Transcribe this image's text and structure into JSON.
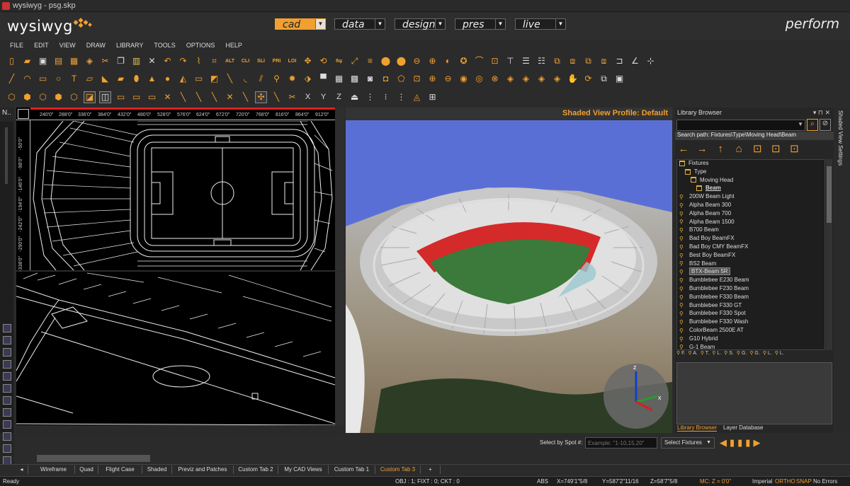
{
  "window": {
    "title": "wysiwyg - psg.skp"
  },
  "header": {
    "logo": "wysiwyg",
    "modes": [
      {
        "label": "cad",
        "active": true
      },
      {
        "label": "data",
        "active": false
      },
      {
        "label": "design",
        "active": false
      },
      {
        "label": "pres",
        "active": false
      },
      {
        "label": "live",
        "active": false
      }
    ],
    "perform": "perform"
  },
  "menu": [
    "FILE",
    "EDIT",
    "VIEW",
    "DRAW",
    "LIBRARY",
    "TOOLS",
    "OPTIONS",
    "HELP"
  ],
  "toolbar_labels": {
    "alt": "ALT",
    "cli": "CLI",
    "sli": "SLI",
    "pri": "PRI",
    "loi": "LOI",
    "x": "X",
    "y": "Y",
    "z": "Z"
  },
  "left_strip": {
    "label": "N.."
  },
  "wireframe_view": {
    "ruler_ticks": [
      "240'0\"",
      "288'0\"",
      "336'0\"",
      "384'0\"",
      "432'0\"",
      "480'0\"",
      "528'0\"",
      "576'0\"",
      "624'0\"",
      "672'0\"",
      "720'0\"",
      "768'0\"",
      "816'0\"",
      "864'0\"",
      "912'0\""
    ],
    "v_ticks": [
      "-50'0\"",
      "-98'0\"",
      "-146'0\"",
      "-194'0\"",
      "-242'0\"",
      "-290'0\"",
      "-338'0\""
    ]
  },
  "shaded_view": {
    "profile": "Shaded View Profile: Default"
  },
  "library": {
    "title": "Library Browser",
    "search_path": "Search path: Fixtures\\Type\\Moving Head\\Beam",
    "tree": [
      {
        "label": "Fixtures",
        "type": "folder",
        "indent": 0
      },
      {
        "label": "Type",
        "type": "folder",
        "indent": 1
      },
      {
        "label": "Moving Head",
        "type": "folder",
        "indent": 2
      },
      {
        "label": "Beam",
        "type": "folder-open",
        "indent": 3
      },
      {
        "label": "200W Beam Light",
        "type": "fixture",
        "indent": 0
      },
      {
        "label": "Alpha Beam 300",
        "type": "fixture",
        "indent": 0
      },
      {
        "label": "Alpha Beam 700",
        "type": "fixture",
        "indent": 0
      },
      {
        "label": "Alpha Beam 1500",
        "type": "fixture",
        "indent": 0
      },
      {
        "label": "B700 Beam",
        "type": "fixture",
        "indent": 0
      },
      {
        "label": "Bad Boy BeamFX",
        "type": "fixture",
        "indent": 0
      },
      {
        "label": "Bad Boy CMY BeamFX",
        "type": "fixture",
        "indent": 0
      },
      {
        "label": "Best Boy BeamFX",
        "type": "fixture",
        "indent": 0
      },
      {
        "label": "BS2 Beam",
        "type": "fixture",
        "indent": 0
      },
      {
        "label": "BTX-Beam 5R",
        "type": "fixture",
        "indent": 0,
        "selected": true
      },
      {
        "label": "Bumblebee E230 Beam",
        "type": "fixture",
        "indent": 0
      },
      {
        "label": "Bumblebee F230 Beam",
        "type": "fixture",
        "indent": 0
      },
      {
        "label": "Bumblebee F330 Beam",
        "type": "fixture",
        "indent": 0
      },
      {
        "label": "Bumblebee F330 GT",
        "type": "fixture",
        "indent": 0
      },
      {
        "label": "Bumblebee F330 Spot",
        "type": "fixture",
        "indent": 0
      },
      {
        "label": "Bumblebee F330 Wash",
        "type": "fixture",
        "indent": 0
      },
      {
        "label": "ColorBeam 2500E AT",
        "type": "fixture",
        "indent": 0
      },
      {
        "label": "G10 Hybrid",
        "type": "fixture",
        "indent": 0
      },
      {
        "label": "G-1 Beam",
        "type": "fixture",
        "indent": 0
      }
    ],
    "filter_icons": [
      "F.",
      "A.",
      "T.",
      "L.",
      "S.",
      "G.",
      "G.",
      "L.",
      "L."
    ],
    "tabs": [
      "Library Browser",
      "Layer Database"
    ],
    "side_tab": "Shaded View Settings"
  },
  "spot_bar": {
    "label": "Select by Spot #:",
    "placeholder": "Example: \"1-10,15,20\"",
    "select_fixtures": "Select Fixtures"
  },
  "view_tabs": [
    {
      "label": "Wireframe",
      "active": false
    },
    {
      "label": "Quad",
      "active": false
    },
    {
      "label": "Flight Case",
      "active": false
    },
    {
      "label": "Shaded",
      "active": false
    },
    {
      "label": "Previz and Patches",
      "active": false
    },
    {
      "label": "Custom Tab 2",
      "active": false
    },
    {
      "label": "My CAD Views",
      "active": false
    },
    {
      "label": "Custom Tab 1",
      "active": false
    },
    {
      "label": "Custom Tab 3",
      "active": true
    },
    {
      "label": "+",
      "active": false
    }
  ],
  "status": {
    "ready": "Ready",
    "obj": "OBJ : 1; FIXT : 0; CKT : 0",
    "abs": "ABS",
    "x": "X=749'1\"5/8",
    "y": "Y=587'2\"11/16",
    "z": "Z=58'7\"5/8",
    "mc": "MC: Z = 0'0\"",
    "imperial": "Imperial",
    "ortho": "ORTHO",
    "snap": "SNAP",
    "errors": "No Errors"
  },
  "colors": {
    "accent": "#f0a030",
    "sky": "#5a6fd6",
    "grass": "#3b7a3a",
    "seats": "#d42a2a"
  }
}
